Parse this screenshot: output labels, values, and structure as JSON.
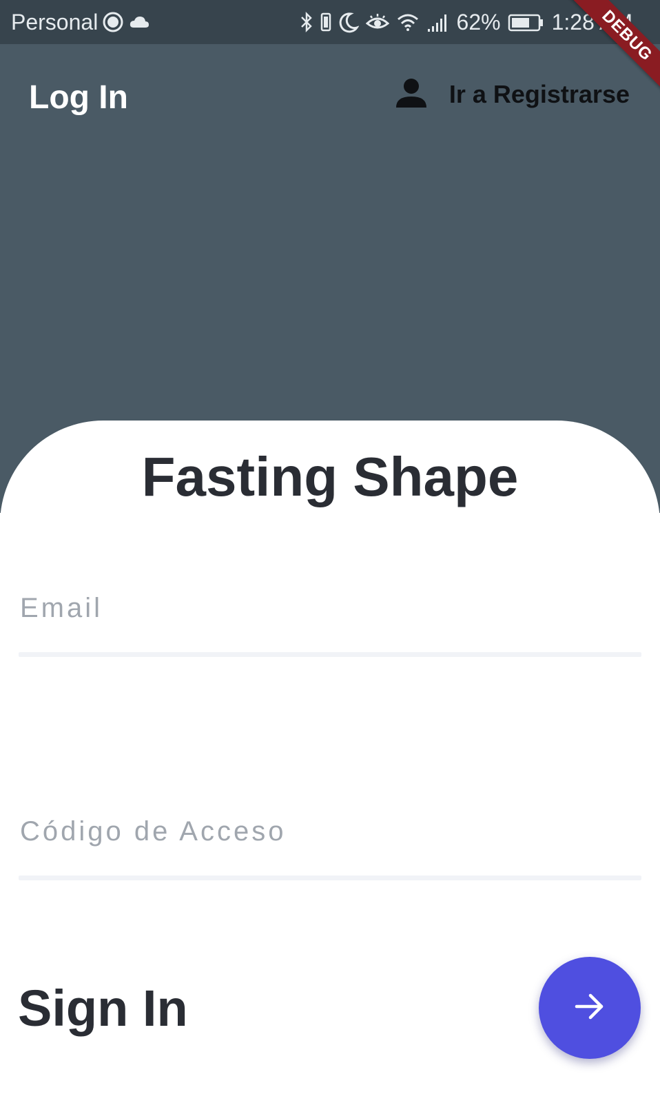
{
  "status_bar": {
    "carrier": "Personal",
    "battery_percent": "62%",
    "time": "1:28 AM",
    "icons": [
      "sync-icon",
      "cloud-icon",
      "bluetooth-icon",
      "vibrate-icon",
      "moon-icon",
      "eye-icon",
      "wifi-icon",
      "signal-icon",
      "battery-icon"
    ]
  },
  "debug_banner": "DEBUG",
  "header": {
    "title": "Log In",
    "register_label": "Ir a Registrarse",
    "register_icon": "person-icon"
  },
  "card": {
    "brand": "Fasting Shape",
    "email": {
      "placeholder": "Email",
      "value": ""
    },
    "access_code": {
      "placeholder": "Código de Acceso",
      "value": ""
    },
    "sign_in_label": "Sign In",
    "submit_icon": "arrow-right-icon"
  },
  "colors": {
    "status_bar": "#37444d",
    "header_bg": "#4a5a65",
    "card_bg": "#ffffff",
    "text_dark": "#2a2d34",
    "placeholder": "#a0a6ae",
    "fab": "#4f4fe0",
    "debug_ribbon": "#8a1c22"
  }
}
